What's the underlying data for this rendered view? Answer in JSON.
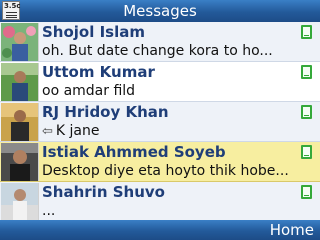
{
  "header": {
    "title": "Messages",
    "app_icon_label": "3.5c"
  },
  "conversations": [
    {
      "name": "Shojol Islam",
      "preview": "oh. But date change kora to ho...",
      "icon": "message-icon"
    },
    {
      "name": "Uttom Kumar",
      "preview": "oo amdar fild",
      "icon": "message-icon"
    },
    {
      "name": "RJ Hridoy Khan",
      "preview": "K jane",
      "icon": "message-icon",
      "replied": true
    },
    {
      "name": "Istiak Ahmmed Soyeb",
      "preview": "Desktop diye eta hoyto thik hobe...",
      "icon": "message-icon",
      "selected": true
    },
    {
      "name": "Shahrin Shuvo",
      "preview": "...",
      "icon": "message-icon"
    }
  ],
  "softkeys": {
    "right": "Home"
  },
  "colors": {
    "bar": "#235a9a",
    "name": "#1f3e78",
    "selected_row": "#f7eea0",
    "message_icon": "#35a93a"
  }
}
